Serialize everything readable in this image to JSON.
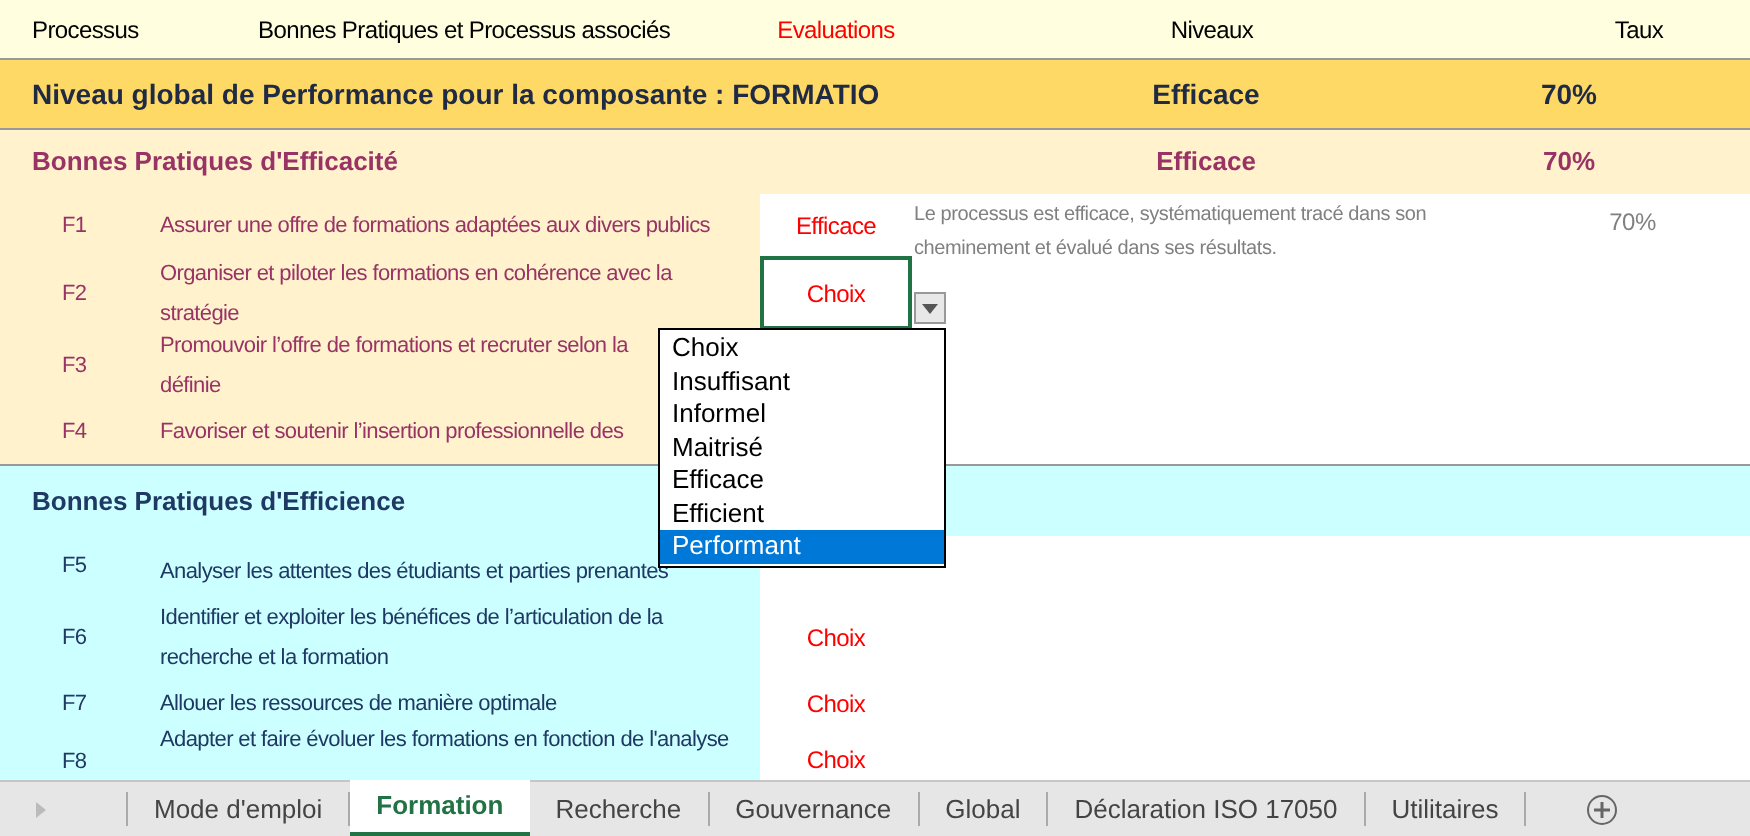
{
  "header": {
    "columns": [
      "Processus",
      "Bonnes Pratiques et Processus associés",
      "Evaluations",
      "Niveaux",
      "Taux"
    ]
  },
  "overall": {
    "label": "Niveau global de Performance pour la composante : FORMATIO",
    "level": "Efficace",
    "rate": "70%"
  },
  "sections": [
    {
      "kind": "efficacite",
      "title": "Bonnes Pratiques d'Efficacité",
      "level": "Efficace",
      "rate": "70%",
      "rows": [
        {
          "code": "F1",
          "text": "Assurer une offre de formations adaptées aux divers publics",
          "evaluation": "Efficace",
          "comment": "Le processus est efficace, systématiquement tracé dans son cheminement et évalué dans ses résultats.",
          "rate": "70%",
          "selected": false
        },
        {
          "code": "F2",
          "text": "Organiser et piloter les formations en cohérence avec la",
          "text_2": "stratégie",
          "evaluation": "Choix",
          "selected": true
        },
        {
          "code": "F3",
          "text": "Promouvoir l’offre de formations et recruter selon la",
          "text_2": "définie"
        },
        {
          "code": "F4",
          "text": "Favoriser et soutenir l’insertion professionnelle des"
        }
      ]
    },
    {
      "kind": "efficience",
      "title": "Bonnes Pratiques d'Efficience",
      "rows": [
        {
          "code": "F5",
          "text": "Analyser les attentes des étudiants et parties prenantes"
        },
        {
          "code": "F6",
          "text": "Identifier et exploiter les bénéfices de l’articulation de la",
          "text_2": "recherche et la formation",
          "evaluation": "Choix",
          "selected": false
        },
        {
          "code": "F7",
          "text": "Allouer les ressources de manière optimale",
          "evaluation": "Choix",
          "selected": false
        },
        {
          "code": "F8",
          "text": "Adapter et faire évoluer les formations en fonction de l'analyse",
          "evaluation": "Choix",
          "selected": false
        }
      ]
    }
  ],
  "dropdown": {
    "options": [
      {
        "label": "Choix",
        "selected": false
      },
      {
        "label": "Insuffisant",
        "selected": false
      },
      {
        "label": "Informel",
        "selected": false
      },
      {
        "label": "Maitrisé",
        "selected": false
      },
      {
        "label": "Efficace",
        "selected": false
      },
      {
        "label": "Efficient",
        "selected": false
      },
      {
        "label": "Performant",
        "selected": true
      }
    ]
  },
  "sheet_tabs": [
    {
      "label": "Mode d'emploi",
      "selected": false
    },
    {
      "label": "Formation",
      "selected": true
    },
    {
      "label": "Recherche",
      "selected": false
    },
    {
      "label": "Gouvernance",
      "selected": false
    },
    {
      "label": "Global",
      "selected": false
    },
    {
      "label": "Déclaration ISO 17050",
      "selected": false
    },
    {
      "label": "Utilitaires",
      "selected": false
    }
  ]
}
